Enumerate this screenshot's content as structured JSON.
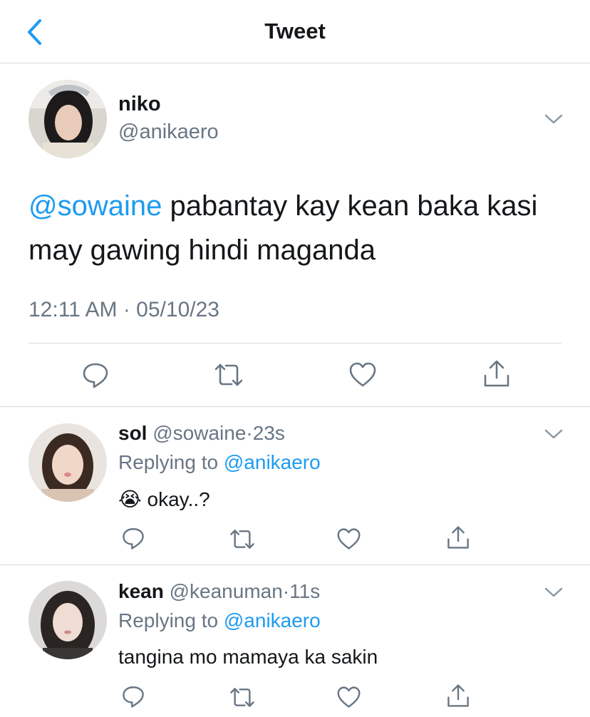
{
  "header": {
    "title": "Tweet"
  },
  "main_tweet": {
    "display_name": "niko",
    "handle": "@anikaero",
    "mention": "@sowaine",
    "text": " pabantay kay kean baka kasi may gawing hindi maganda",
    "timestamp": "12:11 AM · 05/10/23"
  },
  "replies": [
    {
      "display_name": "sol",
      "handle": "@sowaine",
      "dot": "·",
      "time": "23s",
      "replying_prefix": "Replying to ",
      "replying_to": "@anikaero",
      "emoji": "😭",
      "text": "okay..?"
    },
    {
      "display_name": "kean",
      "handle": "@keanuman",
      "dot": "·",
      "time": "11s",
      "replying_prefix": "Replying to ",
      "replying_to": "@anikaero",
      "text": "tangina mo mamaya ka sakin"
    }
  ],
  "colors": {
    "accent": "#1d9bf0",
    "muted": "#687684",
    "divider": "#d6d9dc"
  },
  "icons": [
    "back-chevron-icon",
    "chevron-down-icon",
    "reply-icon",
    "retweet-icon",
    "like-icon",
    "share-icon"
  ]
}
